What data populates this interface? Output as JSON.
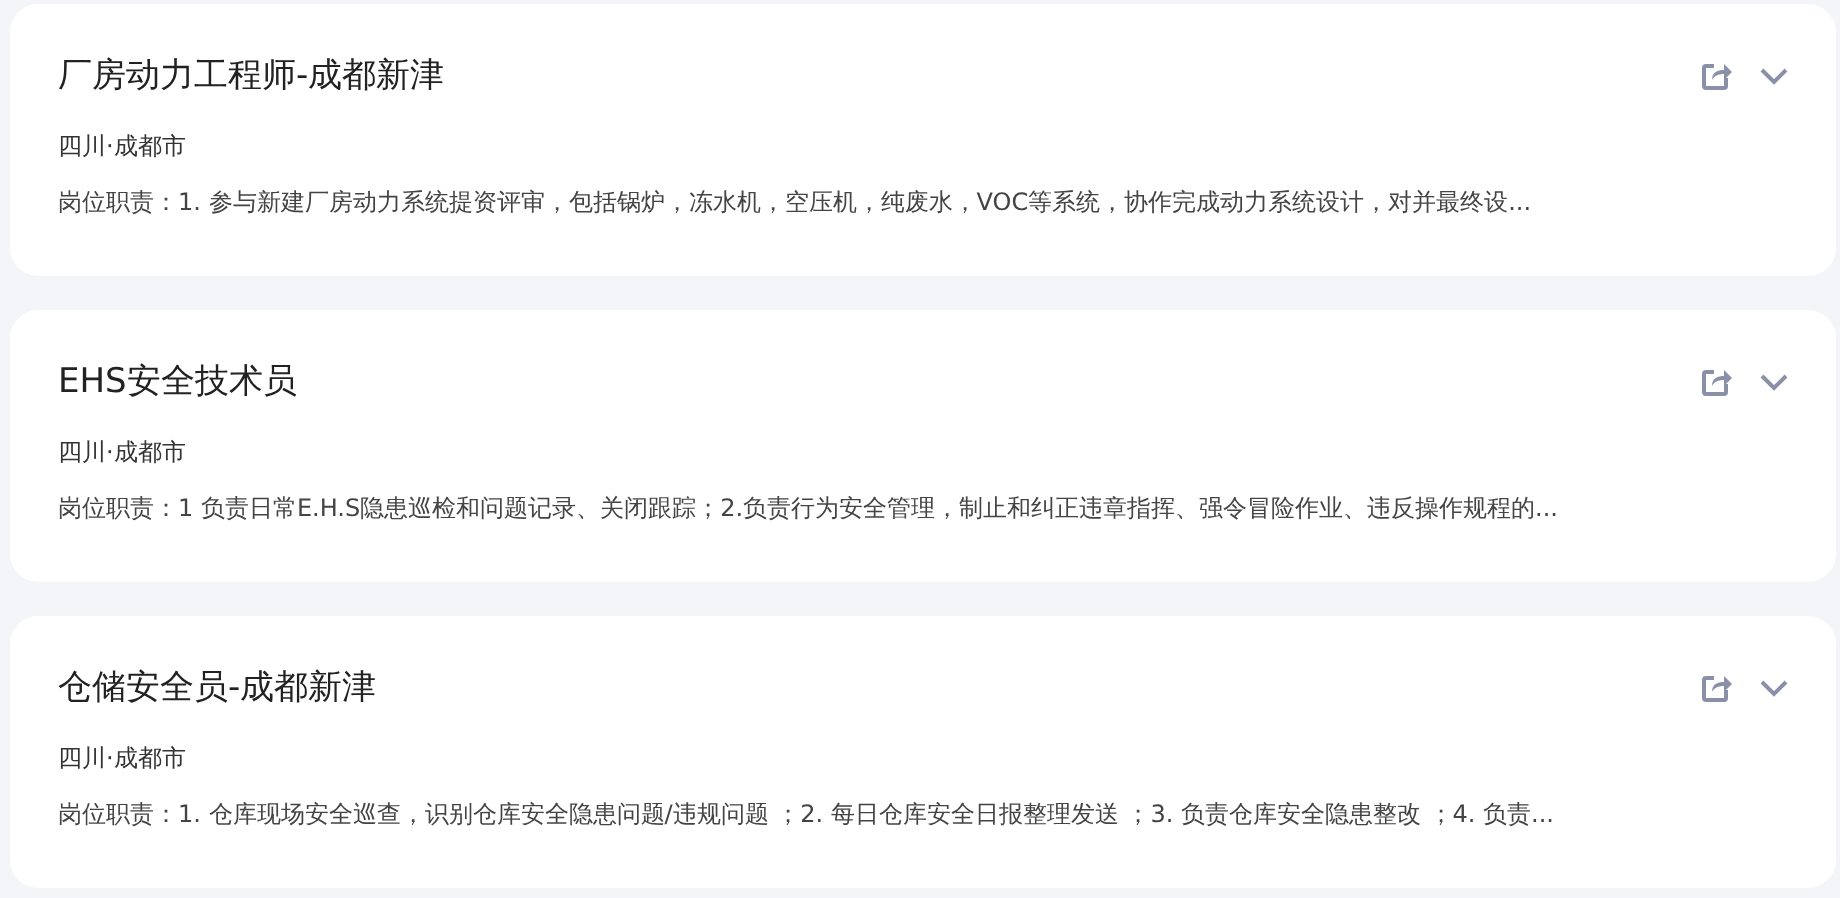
{
  "jobs": [
    {
      "title": "厂房动力工程师-成都新津",
      "location": "四川·成都市",
      "description": "岗位职责：1. 参与新建厂房动力系统提资评审，包括锅炉，冻水机，空压机，纯废水，VOC等系统，协作完成动力系统设计，对并最终设..."
    },
    {
      "title": "EHS安全技术员",
      "location": "四川·成都市",
      "description": "岗位职责：1 负责日常E.H.S隐患巡检和问题记录、关闭跟踪；2.负责行为安全管理，制止和纠正违章指挥、强令冒险作业、违反操作规程的..."
    },
    {
      "title": "仓储安全员-成都新津",
      "location": "四川·成都市",
      "description": "岗位职责：1. 仓库现场安全巡查，识别仓库安全隐患问题/违规问题 ；2. 每日仓库安全日报整理发送 ；3. 负责仓库安全隐患整改 ；4. 负责..."
    }
  ]
}
